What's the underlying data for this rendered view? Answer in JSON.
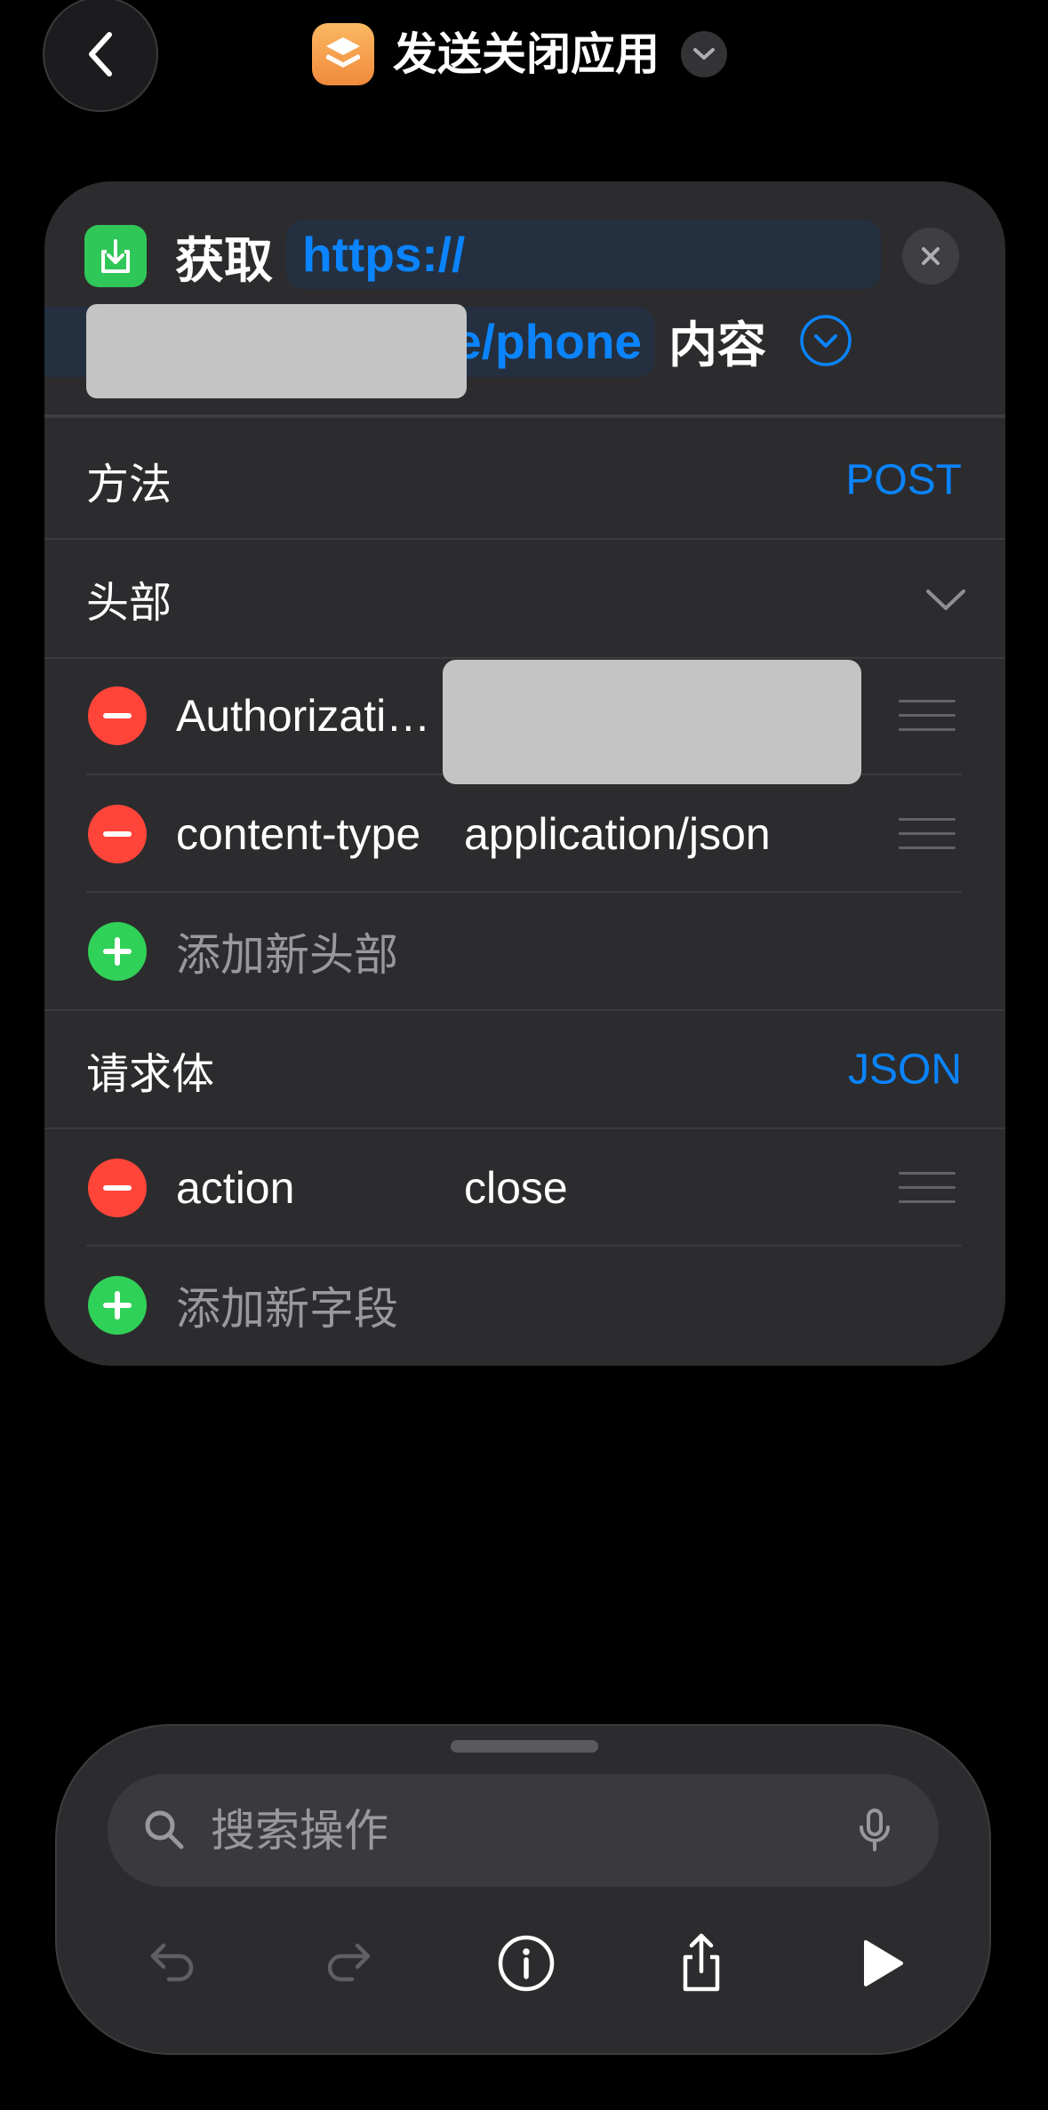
{
  "nav": {
    "title": "发送关闭应用",
    "back_icon": "chevron-left-icon",
    "app_icon": "layers-icon",
    "menu_icon": "chevron-down-icon"
  },
  "action": {
    "icon": "download-icon",
    "verb": "获取",
    "url_start": "https://",
    "url_end": "e/phone",
    "noun": "内容",
    "clear_icon": "close-icon",
    "expand_icon": "chevron-down-circle-icon"
  },
  "method": {
    "label": "方法",
    "value": "POST"
  },
  "headers": {
    "label": "头部",
    "expand_icon": "chevron-down-icon",
    "items": [
      {
        "key": "Authorizati…"
      },
      {
        "key": "content-type",
        "value": "application/json"
      }
    ],
    "add_label": "添加新头部"
  },
  "body": {
    "label": "请求体",
    "type": "JSON",
    "items": [
      {
        "key": "action",
        "value": "close"
      }
    ],
    "add_label": "添加新字段"
  },
  "search": {
    "placeholder": "搜索操作",
    "icon": "search-icon",
    "mic_icon": "microphone-icon"
  },
  "toolbar": {
    "icons": [
      "undo-icon",
      "redo-icon",
      "info-icon",
      "share-icon",
      "play-icon"
    ]
  },
  "colors": {
    "background": "#000000",
    "card": "#2c2c2e",
    "accent": "#0a84ff",
    "remove": "#ff453a",
    "add": "#30d158",
    "app_icon": "#f5a04a"
  }
}
